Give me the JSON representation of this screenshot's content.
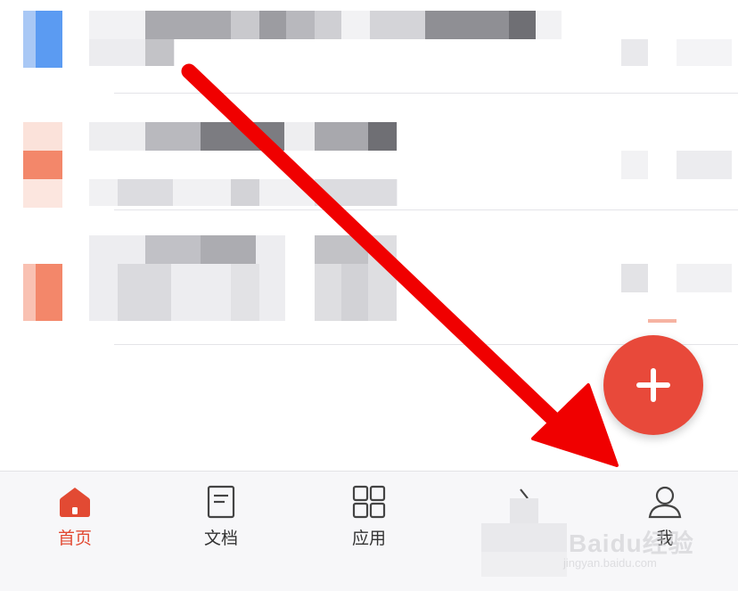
{
  "tabbar": {
    "tabs": [
      {
        "label": "首页",
        "icon": "home-icon",
        "active": true
      },
      {
        "label": "文档",
        "icon": "document-icon",
        "active": false
      },
      {
        "label": "应用",
        "icon": "apps-grid-icon",
        "active": false
      },
      {
        "label": "",
        "icon": "share-icon",
        "active": false
      },
      {
        "label": "我",
        "icon": "person-icon",
        "active": false
      }
    ]
  },
  "fab": {
    "icon": "plus-icon"
  },
  "colors": {
    "accent": "#e24a33",
    "fab": "#e8493a",
    "arrow": "#f00000",
    "thumb_blue": "#5b9bf2",
    "thumb_orange": "#f3876a"
  },
  "watermark": {
    "main": "Baidu经验",
    "sub": "jingyan.baidu.com"
  }
}
